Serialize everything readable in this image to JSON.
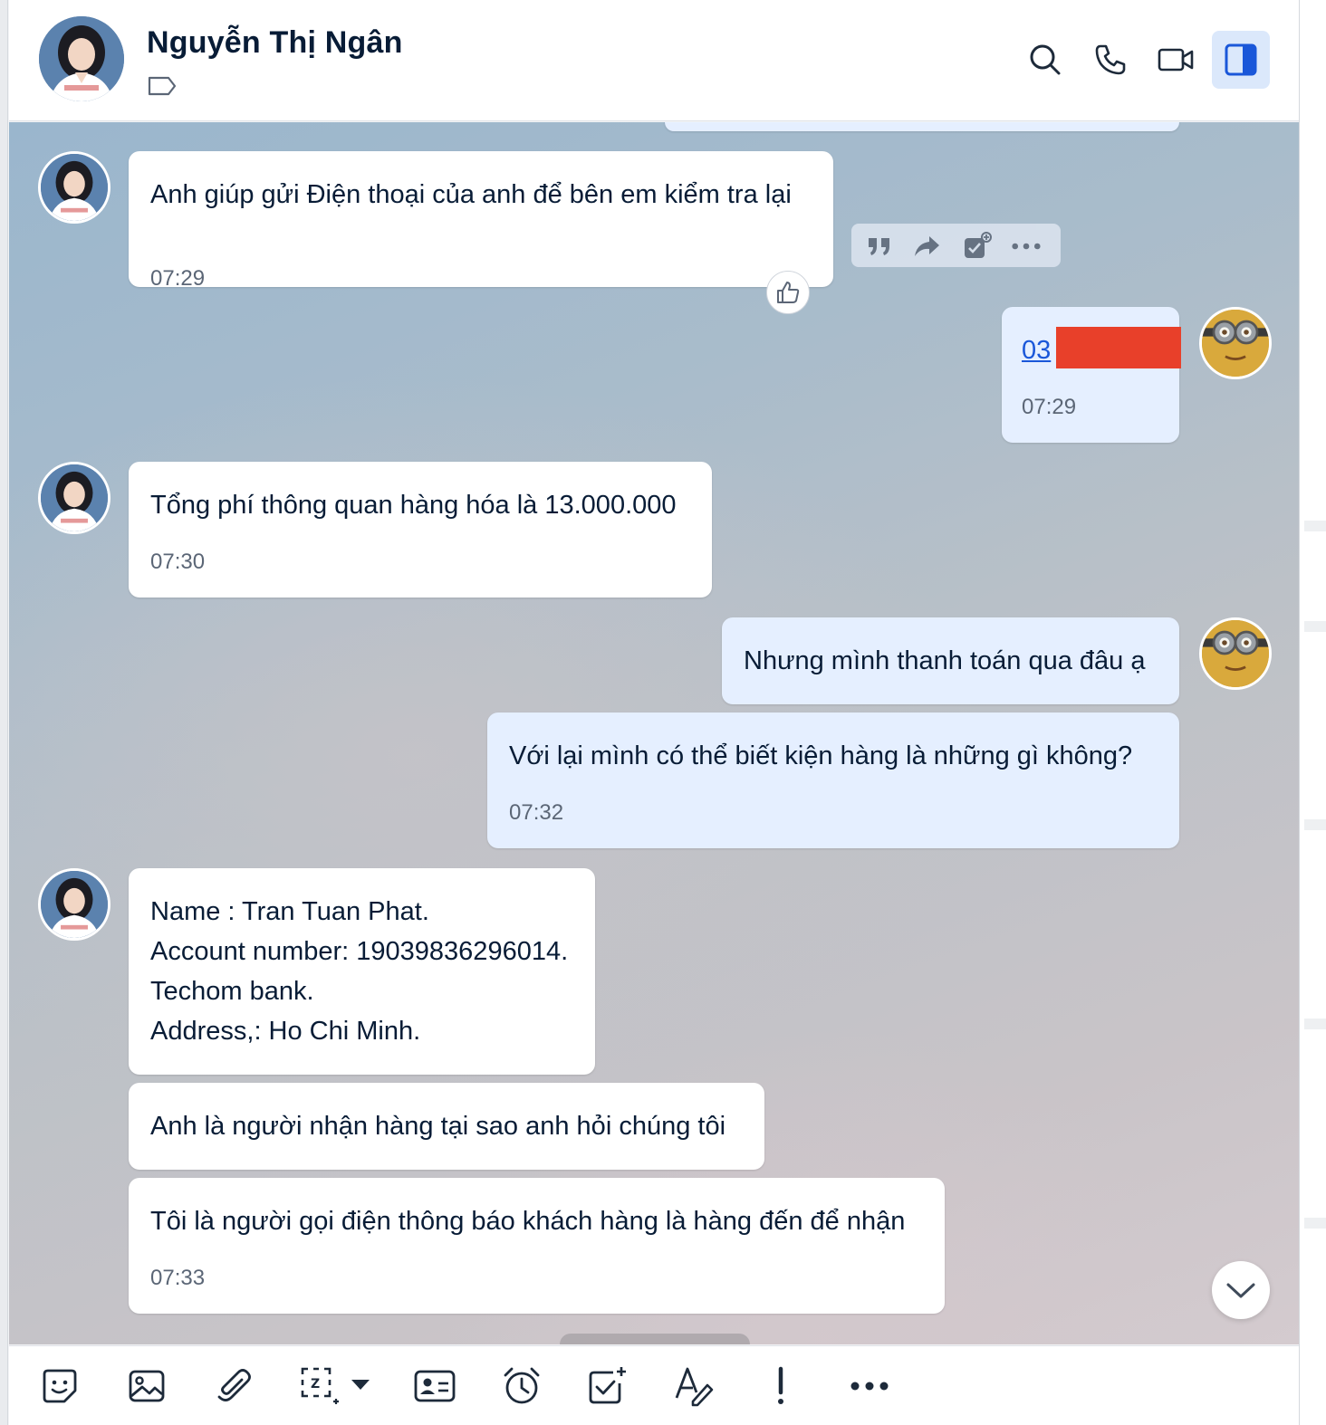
{
  "header": {
    "contact_name": "Nguyễn Thị Ngân",
    "icons": [
      "search-icon",
      "phone-icon",
      "video-call-icon",
      "sidebar-toggle-icon"
    ],
    "tag_icon": "label-tag-icon"
  },
  "messages": [
    {
      "id": "m1",
      "direction": "incoming",
      "text": "Anh giúp gửi Điện thoại của anh để bên em kiểm tra lại",
      "time": "07:29"
    },
    {
      "id": "m2",
      "direction": "outgoing",
      "text": "03",
      "time": "07:29",
      "redacted": true
    },
    {
      "id": "m3",
      "direction": "incoming",
      "text": "Tổng phí thông quan hàng hóa là 13.000.000",
      "time": "07:30"
    },
    {
      "id": "m4",
      "direction": "outgoing",
      "text": "Nhưng mình thanh toán qua đâu ạ"
    },
    {
      "id": "m5",
      "direction": "outgoing",
      "text": "Với lại mình có thể biết kiện hàng là những gì không?",
      "time": "07:32"
    },
    {
      "id": "m6",
      "direction": "incoming",
      "lines": [
        "Name : Tran Tuan Phat.",
        "Account number: 19039836296014.",
        "Techom bank.",
        "Address,: Ho Chi Minh."
      ]
    },
    {
      "id": "m7",
      "direction": "incoming",
      "text": "Anh là người nhận hàng tại sao anh hỏi chúng tôi"
    },
    {
      "id": "m8",
      "direction": "incoming",
      "text": "Tôi là người gọi điện thông báo khách hàng là hàng đến để nhận",
      "time": "07:33"
    }
  ],
  "message_actions": [
    "quote-icon",
    "forward-icon",
    "add-task-icon",
    "more-icon"
  ],
  "reaction_icon": "thumbs-up-icon",
  "toolbar": {
    "icons": [
      "sticker-icon",
      "image-icon",
      "attachment-icon",
      "screenshot-icon",
      "contact-card-icon",
      "reminder-icon",
      "todo-icon",
      "text-format-icon",
      "urgent-icon",
      "more-icon"
    ]
  },
  "colors": {
    "incoming_bubble": "#ffffff",
    "outgoing_bubble": "#e5efff",
    "accent": "#1a57d9",
    "redaction": "#e8402a"
  }
}
